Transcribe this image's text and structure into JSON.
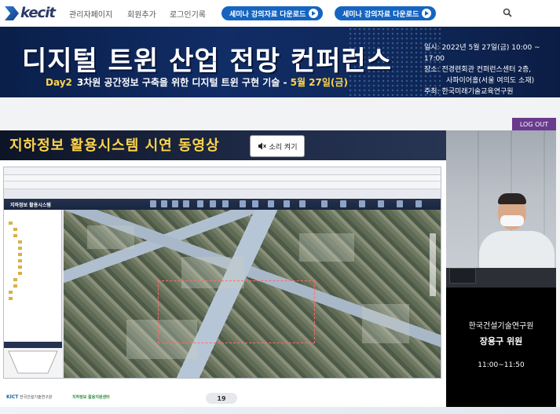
{
  "nav": {
    "logo": "kecit",
    "links": [
      "관리자페이지",
      "회원추가",
      "로그인기록"
    ],
    "download_buttons": [
      "세미나 강의자료 다운로드",
      "세미나 강의자료 다운로드"
    ]
  },
  "banner": {
    "title": "디지털 트윈 산업 전망 컨퍼런스",
    "day": "Day2",
    "subtitle": "3차원 공간정보 구축을 위한 디지털 트윈 구현 기술 - ",
    "date_highlight": "5월 27일(금)",
    "info_date": "일시: 2022년 5월 27일(금) 10:00 ~ 17:00",
    "info_place_1": "장소: 전경련회관 컨퍼런스센터 2층,",
    "info_place_2": "사파이어홀(서울 여의도 소재)",
    "info_host": "주최: 한국미래기술교육연구원"
  },
  "logout_label": "LOG OUT",
  "slide": {
    "title": "지하정보 활용시스템 시연 동영상",
    "sound_button": "소리 켜기",
    "app_name": "지하정보 활용시스템",
    "footer_left_org": "KICT",
    "footer_left_small": "한국건설기술연구원",
    "footer_right_org": "지하정보 활용지원센터",
    "page_number": "19"
  },
  "speaker": {
    "org": "한국건설기술연구원",
    "name": "장용구 위원",
    "time": "11:00~11:50"
  }
}
